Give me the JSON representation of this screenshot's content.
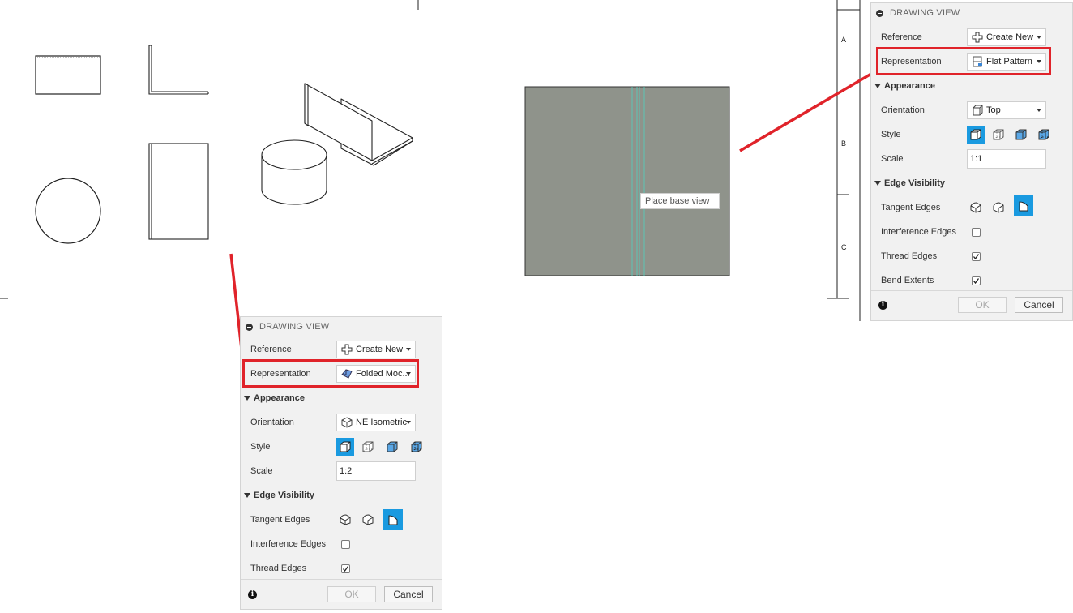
{
  "sheet": {
    "zone_labels": [
      "A",
      "B",
      "C"
    ],
    "place_base_view_tooltip": "Place base view"
  },
  "panel_right": {
    "header": "DRAWING VIEW",
    "reference": {
      "label": "Reference",
      "value": "Create New"
    },
    "representation": {
      "label": "Representation",
      "value": "Flat Pattern"
    },
    "appearance": {
      "title": "Appearance",
      "orientation": {
        "label": "Orientation",
        "value": "Top"
      },
      "style": {
        "label": "Style",
        "selected": "visible-edges"
      },
      "scale": {
        "label": "Scale",
        "value": "1:1"
      }
    },
    "edge_visibility": {
      "title": "Edge Visibility",
      "tangent_edges": {
        "label": "Tangent Edges"
      },
      "interference_edges": {
        "label": "Interference Edges",
        "checked": false
      },
      "thread_edges": {
        "label": "Thread Edges",
        "checked": true
      },
      "bend_extents": {
        "label": "Bend Extents",
        "checked": true
      }
    },
    "ok_label": "OK",
    "cancel_label": "Cancel"
  },
  "panel_left": {
    "header": "DRAWING VIEW",
    "reference": {
      "label": "Reference",
      "value": "Create New"
    },
    "representation": {
      "label": "Representation",
      "value": "Folded Moc..."
    },
    "appearance": {
      "title": "Appearance",
      "orientation": {
        "label": "Orientation",
        "value": "NE Isometric"
      },
      "style": {
        "label": "Style",
        "selected": "visible-edges"
      },
      "scale": {
        "label": "Scale",
        "value": "1:2"
      }
    },
    "edge_visibility": {
      "title": "Edge Visibility",
      "tangent_edges": {
        "label": "Tangent Edges"
      },
      "interference_edges": {
        "label": "Interference Edges",
        "checked": false
      },
      "thread_edges": {
        "label": "Thread Edges",
        "checked": true
      }
    },
    "ok_label": "OK",
    "cancel_label": "Cancel"
  },
  "colors": {
    "highlight": "#e0232a",
    "selected_button": "#1a9ae0",
    "flat_pattern_fill": "#8f938b",
    "bend_line": "#4fd3c0"
  }
}
